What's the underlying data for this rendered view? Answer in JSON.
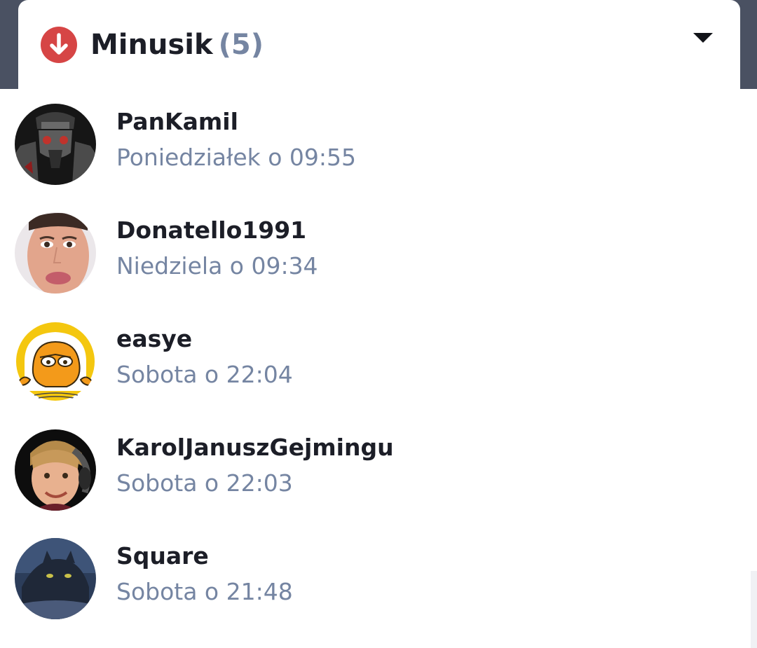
{
  "header": {
    "title": "Minusik",
    "count": "(5)",
    "icon": "arrow-down-circle-icon",
    "toggle_icon": "caret-down-icon",
    "accent_color": "#d64545"
  },
  "voters": [
    {
      "username": "PanKamil",
      "timestamp": "Poniedziałek o 09:55"
    },
    {
      "username": "Donatello1991",
      "timestamp": "Niedziela o 09:34"
    },
    {
      "username": "easye",
      "timestamp": "Sobota o 22:04"
    },
    {
      "username": "KarolJanuszGejmingu",
      "timestamp": "Sobota o 22:03"
    },
    {
      "username": "Square",
      "timestamp": "Sobota o 21:48"
    }
  ]
}
